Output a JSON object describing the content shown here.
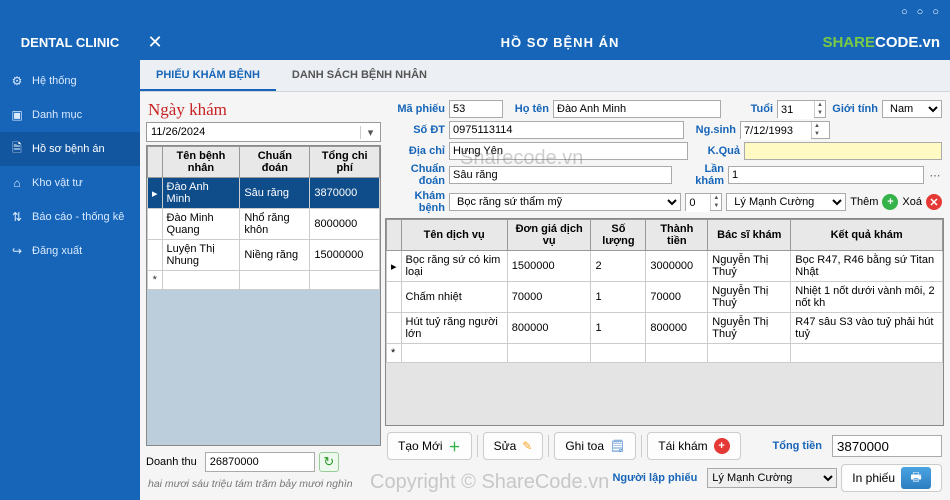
{
  "brand": "DENTAL CLINIC",
  "header": {
    "title": "HỒ SƠ BỆNH ÁN",
    "logo_a": "SHARE",
    "logo_b": "CODE.vn"
  },
  "sidebar": {
    "items": [
      {
        "label": "Hệ thống",
        "icon": "⚙"
      },
      {
        "label": "Danh mục",
        "icon": "▣"
      },
      {
        "label": "Hồ sơ bệnh án",
        "icon": "🗎"
      },
      {
        "label": "Kho vật tư",
        "icon": "⌂"
      },
      {
        "label": "Báo cáo - thống kê",
        "icon": "⇅"
      },
      {
        "label": "Đăng xuất",
        "icon": "↪"
      }
    ]
  },
  "tabs": {
    "items": [
      "PHIẾU KHÁM BỆNH",
      "DANH SÁCH BỆNH NHÂN"
    ]
  },
  "left": {
    "date_label": "Ngày khám",
    "date_value": "11/26/2024",
    "columns": [
      "Tên bệnh nhân",
      "Chuẩn đoán",
      "Tổng chi phí"
    ],
    "rows": [
      [
        "Đào Anh Minh",
        "Sâu răng",
        "3870000"
      ],
      [
        "Đào Minh Quang",
        "Nhổ răng khôn",
        "8000000"
      ],
      [
        "Luyện Thị Nhung",
        "Niềng răng",
        "15000000"
      ]
    ],
    "revenue_label": "Doanh thu",
    "revenue_value": "26870000",
    "revenue_words": "hai mươi sáu triệu tám trăm bảy mươi nghìn"
  },
  "form": {
    "ma_phieu_label": "Mã phiếu",
    "ma_phieu": "53",
    "ho_ten_label": "Họ tên",
    "ho_ten": "Đào Anh Minh",
    "tuoi_label": "Tuổi",
    "tuoi": "31",
    "gioi_tinh_label": "Giới tính",
    "gioi_tinh": "Nam",
    "sodt_label": "Số ĐT",
    "sodt": "0975113114",
    "ngsinh_label": "Ng.sinh",
    "ngsinh": "7/12/1993",
    "diachi_label": "Địa chỉ",
    "diachi": "Hưng Yên",
    "kqua_label": "K.Quả",
    "kqua": "",
    "chuandoan_label": "Chuẩn đoán",
    "chuandoan": "Sâu răng",
    "lankham_label": "Lần khám",
    "lankham": "1",
    "khambenh_label": "Khám bệnh",
    "khambenh_opt": "Bọc răng sứ thẩm mỹ",
    "khambenh_qty": "0",
    "doctor": "Lý Mạnh Cường",
    "them_label": "Thêm",
    "xoa_label": "Xoá"
  },
  "svc": {
    "columns": [
      "Tên dịch vụ",
      "Đơn giá dịch vụ",
      "Số lượng",
      "Thành tiền",
      "Bác sĩ khám",
      "Kết quả khám"
    ],
    "rows": [
      {
        "c": [
          "Bọc răng sứ có kim loại",
          "1500000",
          "2",
          "3000000",
          "Nguyễn Thị Thuỷ",
          "Bọc R47, R46 bằng sứ Titan Nhật"
        ]
      },
      {
        "c": [
          "Chấm nhiệt",
          "70000",
          "1",
          "70000",
          "Nguyễn Thị Thuỷ",
          "Nhiệt 1 nốt dưới vành môi, 2 nốt kh"
        ]
      },
      {
        "c": [
          "Hút tuỷ răng người lớn",
          "800000",
          "1",
          "800000",
          "Nguyễn Thị Thuỷ",
          "R47 sâu S3 vào tuỷ phải hút tuỷ"
        ]
      }
    ]
  },
  "toolbar": {
    "tao_moi": "Tạo Mới",
    "sua": "Sửa",
    "ghitoa": "Ghi toa",
    "taikham": "Tái khám",
    "tong_label": "Tổng tiền",
    "tong_value": "3870000",
    "inphieu": "In phiếu",
    "nguoi_lap_label": "Người lập phiếu",
    "nguoi_lap": "Lý Mạnh Cường"
  },
  "watermarks": {
    "w1": "Sharecode.vn",
    "w2": "Copyright © ShareCode.vn"
  }
}
